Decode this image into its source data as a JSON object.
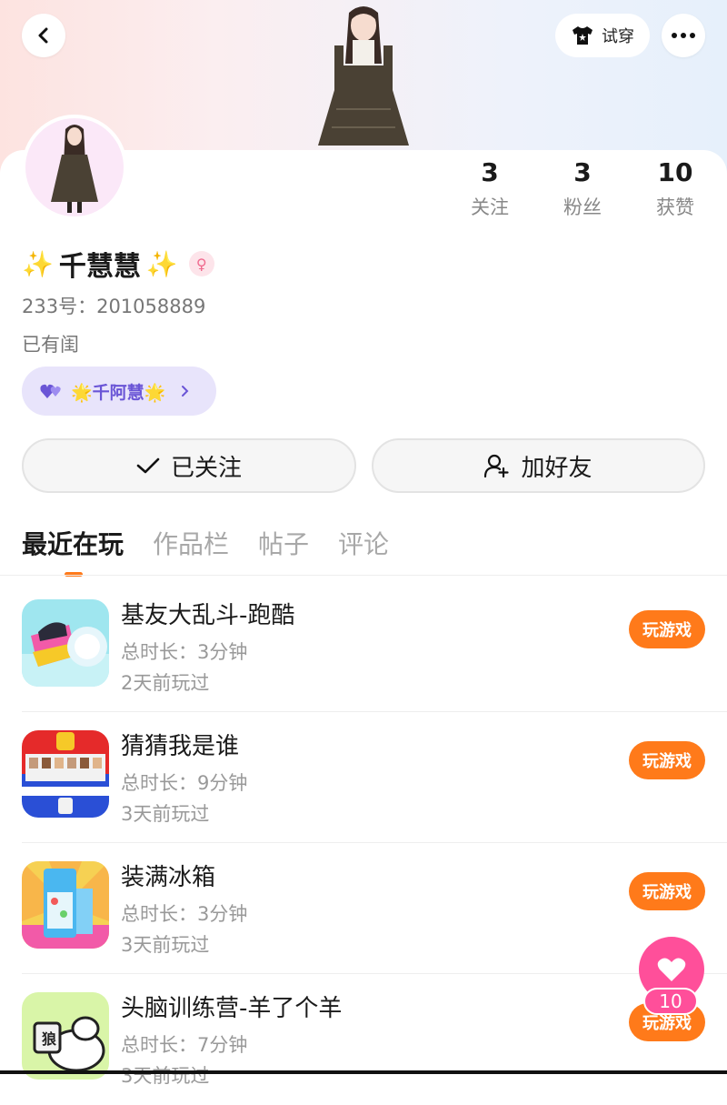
{
  "header": {
    "try_on_label": "试穿"
  },
  "stats": [
    {
      "value": "3",
      "label": "关注"
    },
    {
      "value": "3",
      "label": "粉丝"
    },
    {
      "value": "10",
      "label": "获赞"
    }
  ],
  "profile": {
    "name": "千慧慧",
    "sparkle": "✨",
    "id_line": "233号：201058889",
    "bio": "已有闺",
    "cp_badge": "🌟千阿慧🌟"
  },
  "actions": {
    "followed_label": "已关注",
    "add_friend_label": "加好友"
  },
  "tabs": [
    "最近在玩",
    "作品栏",
    "帖子",
    "评论"
  ],
  "games": [
    {
      "title": "基友大乱斗-跑酷",
      "duration": "总时长：3分钟",
      "last_played": "2天前玩过",
      "button": "玩游戏"
    },
    {
      "title": "猜猜我是谁",
      "duration": "总时长：9分钟",
      "last_played": "3天前玩过",
      "button": "玩游戏"
    },
    {
      "title": "装满冰箱",
      "duration": "总时长：3分钟",
      "last_played": "3天前玩过",
      "button": "玩游戏"
    },
    {
      "title": "头脑训练营-羊了个羊",
      "duration": "总时长：7分钟",
      "last_played": "3天前玩过",
      "button": "玩游戏"
    }
  ],
  "fab": {
    "count": "10"
  },
  "colors": {
    "accent": "#ff7a1a",
    "pink": "#ff4f9a",
    "badge_bg": "#e8e4fb",
    "badge_text": "#6a55d6"
  }
}
